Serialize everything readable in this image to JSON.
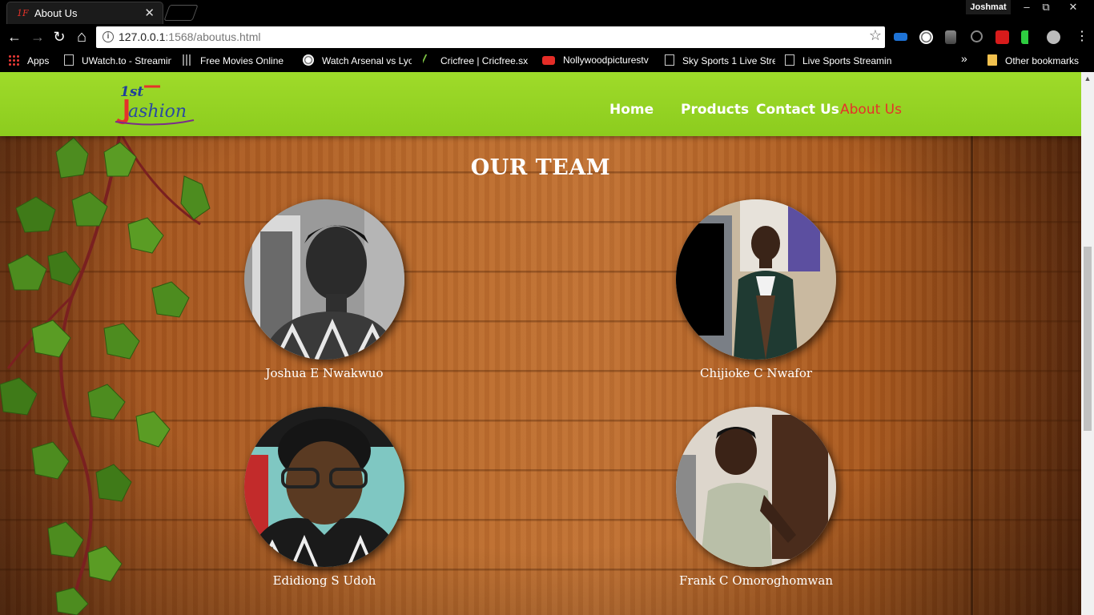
{
  "browser": {
    "tab_title": "About Us",
    "tab_close": "✕",
    "profile_name": "Joshmat",
    "window_controls": [
      "–",
      "⧉",
      "✕"
    ],
    "nav": {
      "back": "←",
      "forward": "→",
      "reload": "↻",
      "home": "⌂"
    },
    "url_host": "127.0.0.1",
    "url_rest": ":1568/aboutus.html",
    "info_icon": "i",
    "star": "☆"
  },
  "bookmarks": {
    "items": [
      "Apps",
      "UWatch.to - Streamin",
      "Free Movies Online",
      "Watch Arsenal vs Lyo",
      "Cricfree | Cricfree.sx",
      "Nollywoodpicturestv",
      "Sky Sports 1 Live Stre",
      "Live Sports Streamin"
    ],
    "overflow": "»",
    "other": "Other bookmarks"
  },
  "site": {
    "logo_top": "1st",
    "logo_bottom": "ashion",
    "nav": [
      "Home",
      "Products",
      "Contact Us",
      "About Us"
    ],
    "active_nav": "About Us",
    "accent": "#e5322a",
    "navbar_color": "#9fdb2a"
  },
  "team": {
    "title": "OUR TEAM",
    "members": [
      {
        "name": "Joshua E Nwakwuo"
      },
      {
        "name": "Chijioke C Nwafor"
      },
      {
        "name": "Edidiong S Udoh"
      },
      {
        "name": "Frank C Omoroghomwan"
      }
    ]
  },
  "scrollbar": {
    "arrow": "▲"
  }
}
